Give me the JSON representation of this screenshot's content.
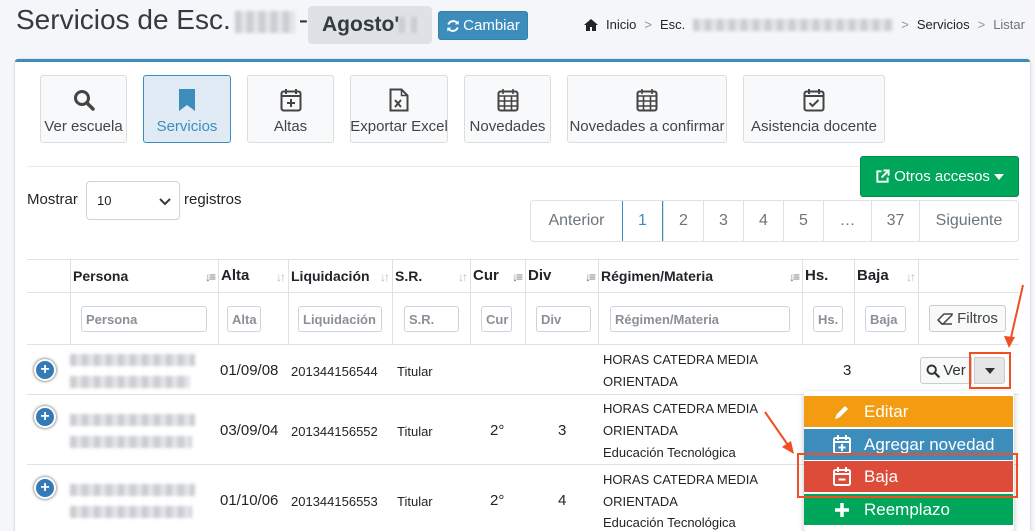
{
  "header": {
    "title": "Servicios de Esc.",
    "title_dash": "-",
    "month": "Agosto'",
    "change_button": "Cambiar"
  },
  "breadcrumb": {
    "home": "Inicio",
    "school": "Esc.",
    "services": "Servicios",
    "list": "Listar",
    "separator": ">"
  },
  "toolbar": {
    "view_school": "Ver escuela",
    "services": "Servicios",
    "altas": "Altas",
    "export_excel": "Exportar Excel",
    "novedades": "Novedades",
    "novedades_confirmar": "Novedades a confirmar",
    "asistencia": "Asistencia docente"
  },
  "other_access": "Otros accesos",
  "length": {
    "show": "Mostrar",
    "value": "10",
    "records": "registros"
  },
  "pagination": {
    "previous": "Anterior",
    "pages": [
      "1",
      "2",
      "3",
      "4",
      "5",
      "…",
      "37"
    ],
    "next": "Siguiente",
    "active": "1"
  },
  "table": {
    "headers": {
      "persona": "Persona",
      "alta": "Alta",
      "liquidacion": "Liquidación",
      "sr": "S.R.",
      "cur": "Cur",
      "div": "Div",
      "regimen": "Régimen/Materia",
      "hs": "Hs.",
      "baja": "Baja"
    },
    "filters": {
      "persona": "Persona",
      "alta": "Alta",
      "liquidacion": "Liquidación",
      "sr": "S.R.",
      "cur": "Cur",
      "div": "Div",
      "regimen": "Régimen/Materia",
      "hs": "Hs.",
      "baja": "Baja",
      "filters_button": "Filtros"
    },
    "rows": [
      {
        "alta": "01/09/08",
        "liquidacion": "201344156544",
        "sr": "Titular",
        "cur": "",
        "div": "",
        "regimen_1": "HORAS CATEDRA MEDIA",
        "regimen_2": "ORIENTADA",
        "regimen_3": "",
        "hs": "3"
      },
      {
        "alta": "03/09/04",
        "liquidacion": "201344156552",
        "sr": "Titular",
        "cur": "2°",
        "div": "3",
        "regimen_1": "HORAS CATEDRA MEDIA",
        "regimen_2": "ORIENTADA",
        "regimen_3": "Educación Tecnológica",
        "hs": ""
      },
      {
        "alta": "01/10/06",
        "liquidacion": "201344156553",
        "sr": "Titular",
        "cur": "2°",
        "div": "4",
        "regimen_1": "HORAS CATEDRA MEDIA",
        "regimen_2": "ORIENTADA",
        "regimen_3": "Educación Tecnológica",
        "hs": ""
      }
    ],
    "view_button": "Ver"
  },
  "dropdown": {
    "items": [
      {
        "label": "Editar",
        "color": "#f39c12",
        "icon": "pencil-icon"
      },
      {
        "label": "Agregar novedad",
        "color": "#3c8dbc",
        "icon": "calendar-plus-icon"
      },
      {
        "label": "Baja",
        "color": "#dd4b39",
        "icon": "calendar-minus-icon"
      },
      {
        "label": "Reemplazo",
        "color": "#00a65a",
        "icon": "plus-icon"
      }
    ]
  },
  "colors": {
    "primary": "#3c8dbc",
    "success": "#00a65a",
    "warning": "#f39c12",
    "danger": "#dd4b39",
    "annotation": "#f04e23"
  }
}
